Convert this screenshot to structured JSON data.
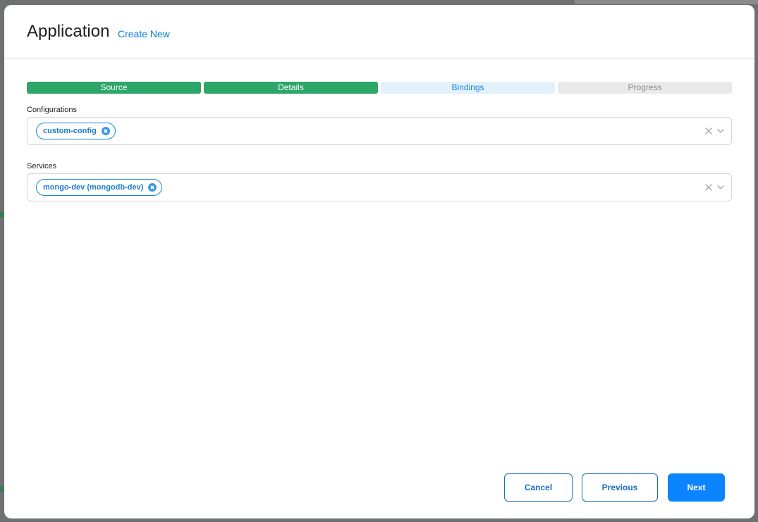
{
  "modal": {
    "title": "Application",
    "create_link": "Create New"
  },
  "steps": [
    {
      "label": "Source",
      "state": "done"
    },
    {
      "label": "Details",
      "state": "done"
    },
    {
      "label": "Bindings",
      "state": "current"
    },
    {
      "label": "Progress",
      "state": "pending"
    }
  ],
  "configurations": {
    "label": "Configurations",
    "selected": [
      "custom-config"
    ],
    "icons": {
      "clear": "clear-icon",
      "toggle": "chevron-down-icon",
      "chip_remove": "close-circle-icon"
    }
  },
  "services": {
    "label": "Services",
    "selected": [
      "mongo-dev (mongodb-dev)"
    ],
    "icons": {
      "clear": "clear-icon",
      "toggle": "chevron-down-icon",
      "chip_remove": "close-circle-icon"
    }
  },
  "footer": {
    "cancel_label": "Cancel",
    "previous_label": "Previous",
    "next_label": "Next"
  },
  "colors": {
    "step_done": "#2ea66a",
    "step_current_bg": "#e3f1fd",
    "step_current_text": "#1a86d8",
    "step_pending_bg": "#e9e9e9",
    "primary": "#0a84ff",
    "outline": "#1a6fc0"
  }
}
